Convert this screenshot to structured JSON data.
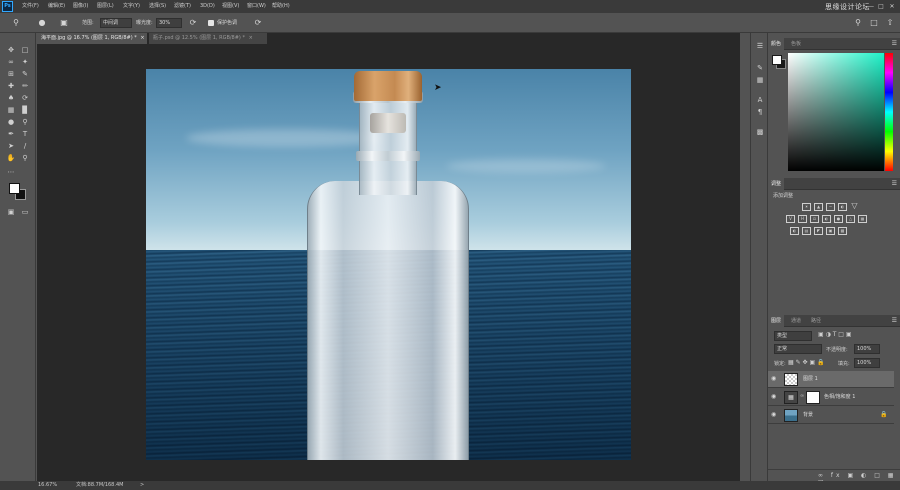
{
  "app": {
    "logo_text": "Ps",
    "brand": "思缘设计论坛"
  },
  "menu": [
    "文件(F)",
    "编辑(E)",
    "图像(I)",
    "图层(L)",
    "文字(Y)",
    "选择(S)",
    "滤镜(T)",
    "3D(D)",
    "视图(V)",
    "窗口(W)",
    "帮助(H)"
  ],
  "window_controls": [
    "—",
    "□",
    "✕"
  ],
  "options": {
    "mode_label": "范围:",
    "mode_value": "中间调",
    "exposure_label": "曝光度:",
    "exposure_value": "30%",
    "protect_label": "保护色调"
  },
  "documents": {
    "active_tab": "海平面.jpg @ 16.7% (图层 1, RGB/8#) *",
    "inactive_tab": "瓶子.psd @ 12.5% (图层 1, RGB/8#) *",
    "close": "×"
  },
  "panels": {
    "color_tabs": [
      "颜色",
      "色板"
    ],
    "adjust_tabs": [
      "调整"
    ],
    "adjust_add_label": "添加调整",
    "layers_tabs": [
      "图层",
      "通道",
      "路径"
    ],
    "layer_filter": "类型",
    "blend_mode": "正常",
    "opacity_label": "不透明度:",
    "opacity_value": "100%",
    "lock_label": "锁定:",
    "fill_label": "填充:",
    "fill_value": "100%",
    "layers": [
      {
        "name": "图层 1"
      },
      {
        "name": "色相/饱和度 1"
      },
      {
        "name": "背景"
      }
    ]
  },
  "status": {
    "zoom": "16.67%",
    "doc_size": "文档:88.7M/168.4M",
    "arrow": ">"
  }
}
